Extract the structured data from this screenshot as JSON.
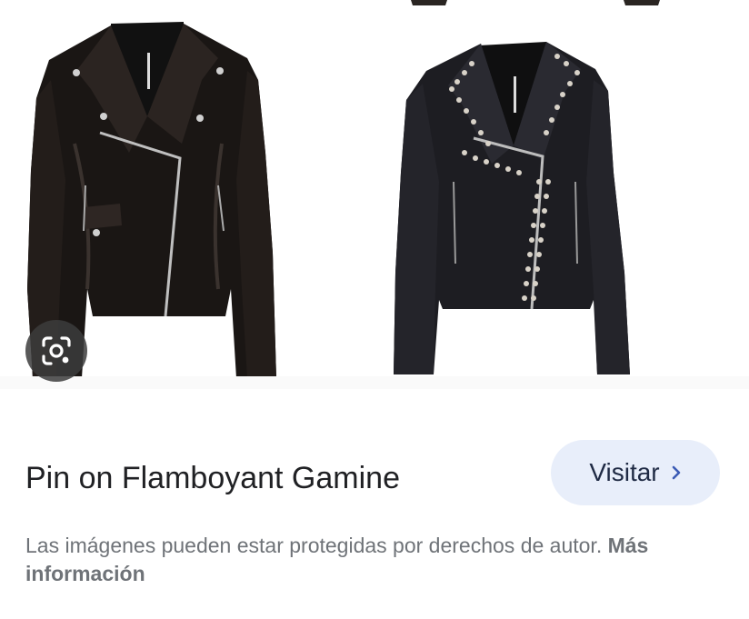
{
  "result": {
    "title": "Pin on Flamboyant Gamine",
    "visit_label": "Visitar",
    "disclaimer_text": "Las imágenes pueden estar protegidas por derechos de autor.",
    "more_info_label": "Más información"
  },
  "icons": {
    "lens": "google-lens-icon",
    "visit_chevron": "chevron-right-icon"
  },
  "colors": {
    "visit_button_bg": "#e8eefa",
    "title_text": "#202124",
    "disclaimer_text": "#6f7378",
    "lens_button_bg": "#3c3c3c"
  }
}
